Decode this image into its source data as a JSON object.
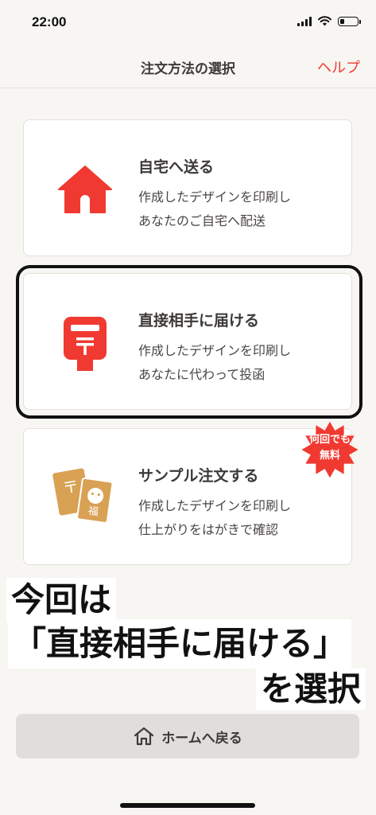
{
  "status_bar": {
    "time": "22:00",
    "icons": [
      "signal-icon",
      "wifi-icon",
      "battery-icon"
    ]
  },
  "nav": {
    "title": "注文方法の選択",
    "help_label": "ヘルプ"
  },
  "options": [
    {
      "title": "自宅へ送る",
      "desc_line1": "作成したデザインを印刷し",
      "desc_line2": "あなたのご自宅へ配送",
      "icon": "house-icon"
    },
    {
      "title": "直接相手に届ける",
      "desc_line1": "作成したデザインを印刷し",
      "desc_line2": "あなたに代わって投函",
      "icon": "postbox-icon",
      "highlighted": true
    },
    {
      "title": "サンプル注文する",
      "desc_line1": "作成したデザインを印刷し",
      "desc_line2": "仕上がりをはがきで確認",
      "icon": "postcard-sample-icon",
      "badge_line1": "何回でも",
      "badge_line2": "無料"
    }
  ],
  "annotation": {
    "line1": "今回は",
    "line2": "「直接相手に届ける」",
    "line3": "を選択"
  },
  "home_button": {
    "label": "ホームへ戻る",
    "icon": "home-outline-icon"
  },
  "colors": {
    "accent_red": "#f03a31",
    "postcard_gold": "#d9a153",
    "background": "#f8f6f2",
    "text_dark": "#3d3a38"
  }
}
